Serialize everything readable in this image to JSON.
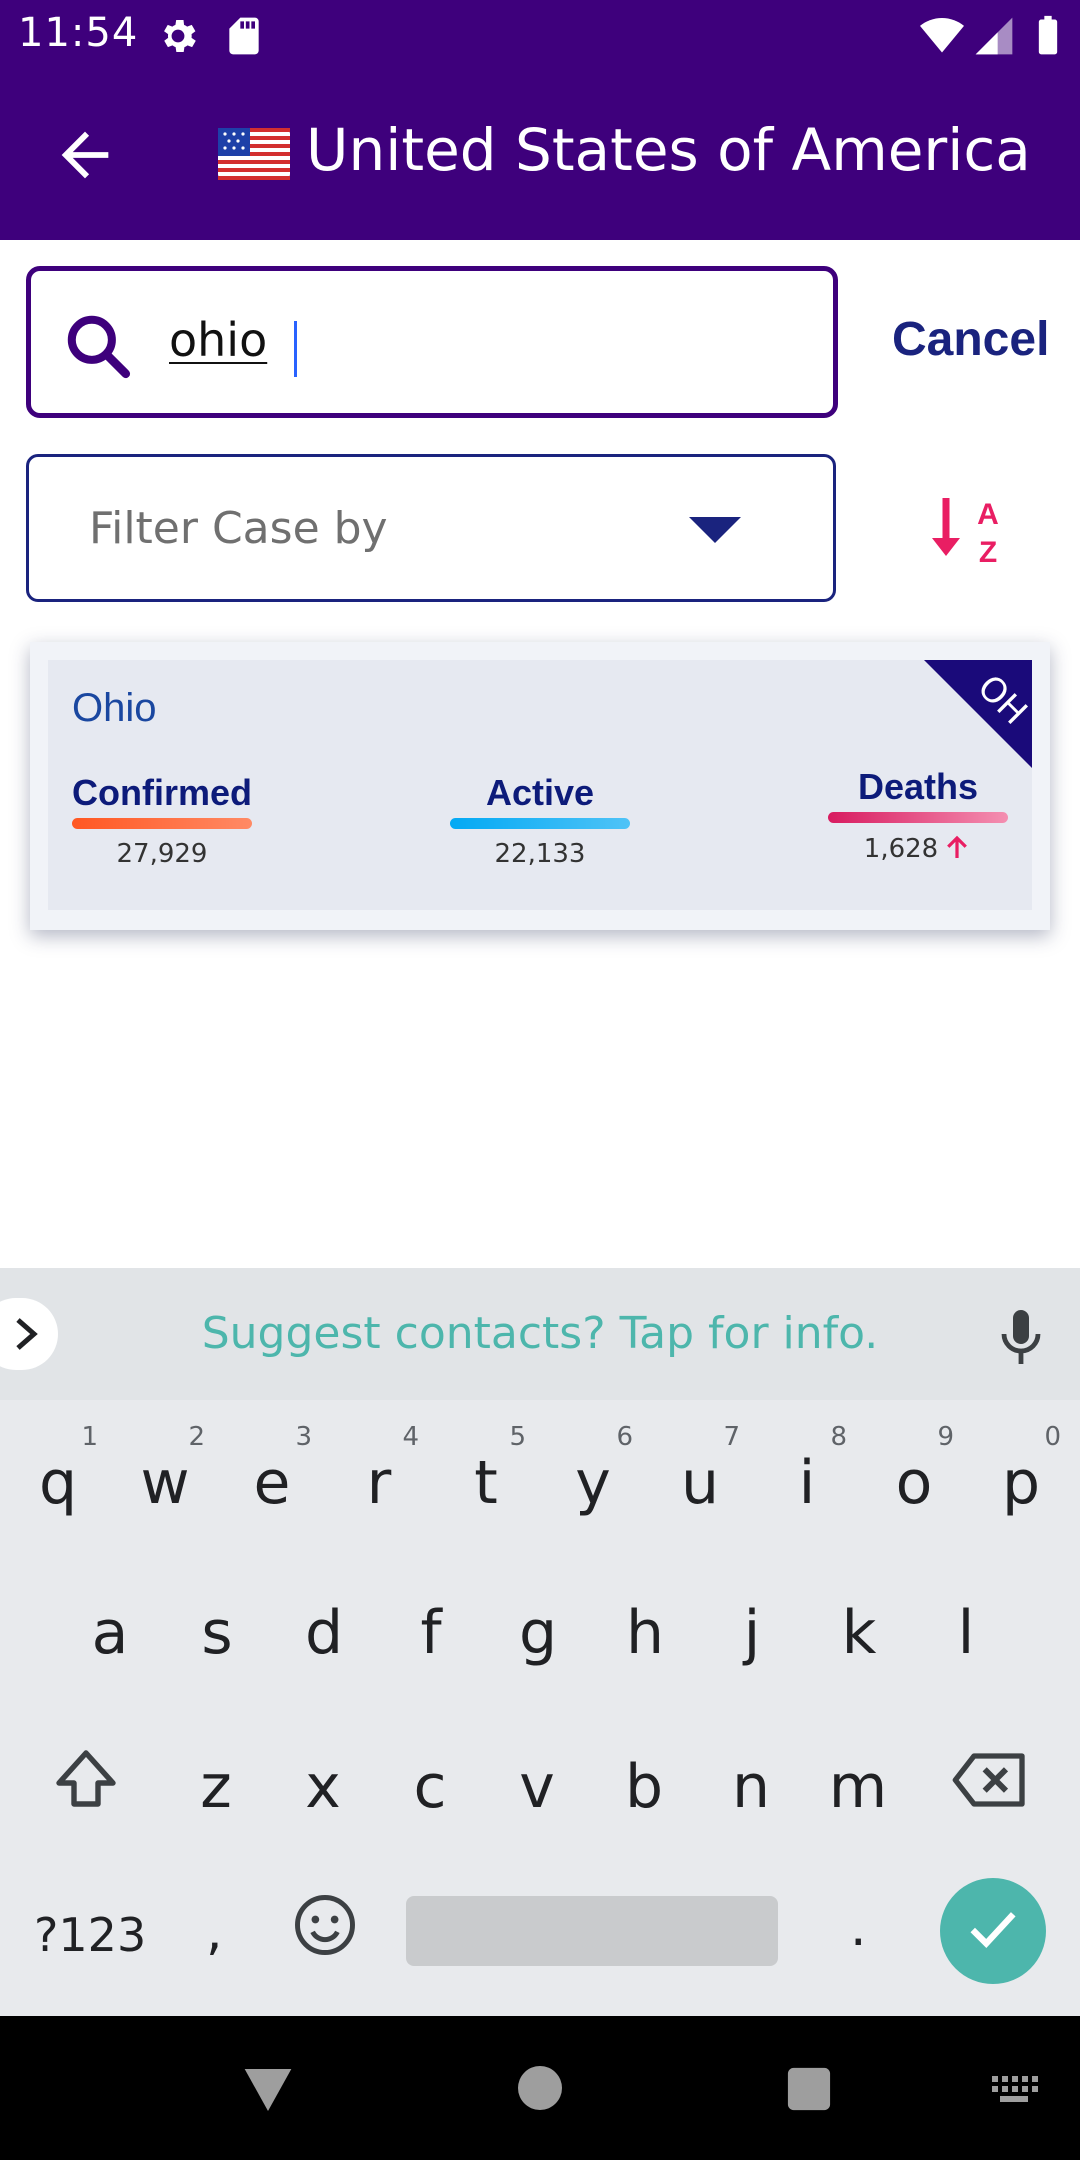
{
  "status_bar": {
    "time": "11:54",
    "icons": [
      "gear-icon",
      "sd-card-icon",
      "wifi-icon",
      "signal-icon",
      "battery-icon"
    ]
  },
  "app_bar": {
    "flag_icon": "us-flag-icon",
    "title": "United States of America",
    "background": "#3e007c"
  },
  "search": {
    "value": "ohio",
    "cancel_label": "Cancel"
  },
  "filter": {
    "placeholder": "Filter Case by",
    "sort_icon": "sort-alpha-desc-icon"
  },
  "result_card": {
    "state_name": "Ohio",
    "state_code": "OH",
    "confirmed": {
      "label": "Confirmed",
      "value": "27,929",
      "color": "#ff5722"
    },
    "active": {
      "label": "Active",
      "value": "22,133",
      "color": "#29b6f6"
    },
    "deaths": {
      "label": "Deaths",
      "value": "1,628",
      "color": "#e91e63",
      "trend": "up"
    }
  },
  "keyboard": {
    "suggestion": "Suggest contacts? Tap for info.",
    "row1": [
      {
        "k": "q",
        "h": "1"
      },
      {
        "k": "w",
        "h": "2"
      },
      {
        "k": "e",
        "h": "3"
      },
      {
        "k": "r",
        "h": "4"
      },
      {
        "k": "t",
        "h": "5"
      },
      {
        "k": "y",
        "h": "6"
      },
      {
        "k": "u",
        "h": "7"
      },
      {
        "k": "i",
        "h": "8"
      },
      {
        "k": "o",
        "h": "9"
      },
      {
        "k": "p",
        "h": "0"
      }
    ],
    "row2": [
      "a",
      "s",
      "d",
      "f",
      "g",
      "h",
      "j",
      "k",
      "l"
    ],
    "row3": [
      "z",
      "x",
      "c",
      "v",
      "b",
      "n",
      "m"
    ],
    "symbols_label": "?123",
    "comma": ",",
    "period": "."
  }
}
